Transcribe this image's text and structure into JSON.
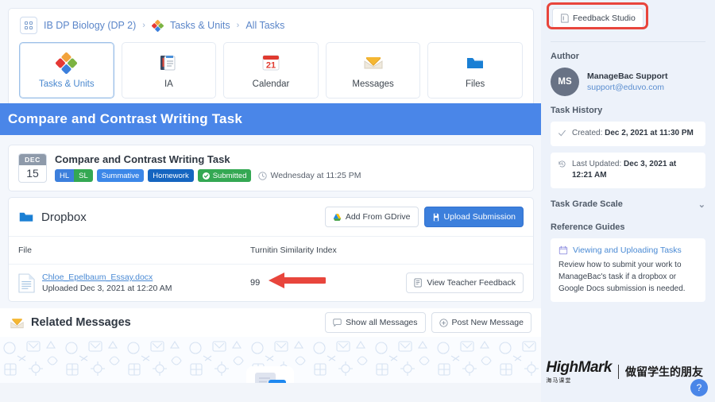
{
  "breadcrumb": {
    "grid_icon": "grid-icon",
    "items": [
      {
        "label": "IB DP Biology (DP 2)",
        "icon": null
      },
      {
        "label": "Tasks & Units",
        "icon": "puzzle-icon"
      },
      {
        "label": "All Tasks",
        "icon": null
      }
    ],
    "separator": "›"
  },
  "tabs": [
    {
      "label": "Tasks & Units",
      "icon": "puzzle-icon",
      "active": true
    },
    {
      "label": "IA",
      "icon": "notebook-icon",
      "active": false
    },
    {
      "label": "Calendar",
      "icon": "calendar-icon",
      "active": false
    },
    {
      "label": "Messages",
      "icon": "envelope-icon",
      "active": false
    },
    {
      "label": "Files",
      "icon": "folder-icon",
      "active": false
    }
  ],
  "page_title": "Compare and Contrast Writing Task",
  "task": {
    "date_month": "DEC",
    "date_day": "15",
    "name": "Compare and Contrast Writing Task",
    "badges": [
      {
        "label": "HL",
        "color": "#3c7fdc"
      },
      {
        "label": "SL",
        "color": "#34a853"
      },
      {
        "label": "Summative",
        "color": "#3c87e8"
      },
      {
        "label": "Homework",
        "color": "#1565c0"
      },
      {
        "label": "Submitted",
        "color": "#34a853",
        "icon": "check-circle-icon"
      }
    ],
    "due_icon": "clock-icon",
    "due_text": "Wednesday at 11:25 PM"
  },
  "dropbox": {
    "icon": "folder-icon",
    "title": "Dropbox",
    "add_gdrive_label": "Add From GDrive",
    "add_gdrive_icon": "gdrive-icon",
    "upload_label": "Upload Submission",
    "upload_icon": "upload-icon",
    "columns": [
      "File",
      "Turnitin Similarity Index"
    ],
    "rows": [
      {
        "file_icon": "document-icon",
        "file_name": "Chloe_Epelbaum_Essay.docx",
        "uploaded": "Uploaded Dec 3, 2021 at 12:20 AM",
        "similarity_index": "99",
        "action_label": "View Teacher Feedback",
        "action_icon": "feedback-icon"
      }
    ]
  },
  "related_messages": {
    "icon": "open-envelope-icon",
    "title": "Related Messages",
    "show_all_label": "Show all Messages",
    "show_all_icon": "comment-icon",
    "post_new_label": "Post New Message",
    "post_new_icon": "plus-circle-icon"
  },
  "sidebar": {
    "feedback_studio": {
      "label": "Feedback Studio",
      "icon": "turnitin-icon",
      "highlight_color": "#e8453c"
    },
    "author_heading": "Author",
    "author": {
      "initials": "MS",
      "name": "ManageBac Support",
      "email": "support@eduvo.com"
    },
    "task_history_heading": "Task History",
    "task_history": [
      {
        "icon": "check-icon",
        "label": "Created:",
        "value": "Dec 2, 2021 at 11:30 PM"
      },
      {
        "icon": "history-icon",
        "label": "Last Updated:",
        "value": "Dec 3, 2021 at 12:21 AM"
      }
    ],
    "task_grade_scale": {
      "label": "Task Grade Scale",
      "chevron": "chevron-down-icon"
    },
    "reference_guides_heading": "Reference Guides",
    "reference_guide": {
      "icon": "book-icon",
      "title": "Viewing and Uploading Tasks",
      "body": "Review how to submit your work to ManageBac's task if a dropbox or Google Docs submission is needed."
    }
  },
  "watermark": {
    "logo": "HighMark",
    "logo_sub": "海马课堂",
    "tagline": "做留学生的朋友"
  },
  "help_button": {
    "label": "?"
  },
  "annotations": {
    "arrow_color": "#e8453c",
    "arrow_target": "turnitin-similarity-index-value"
  }
}
